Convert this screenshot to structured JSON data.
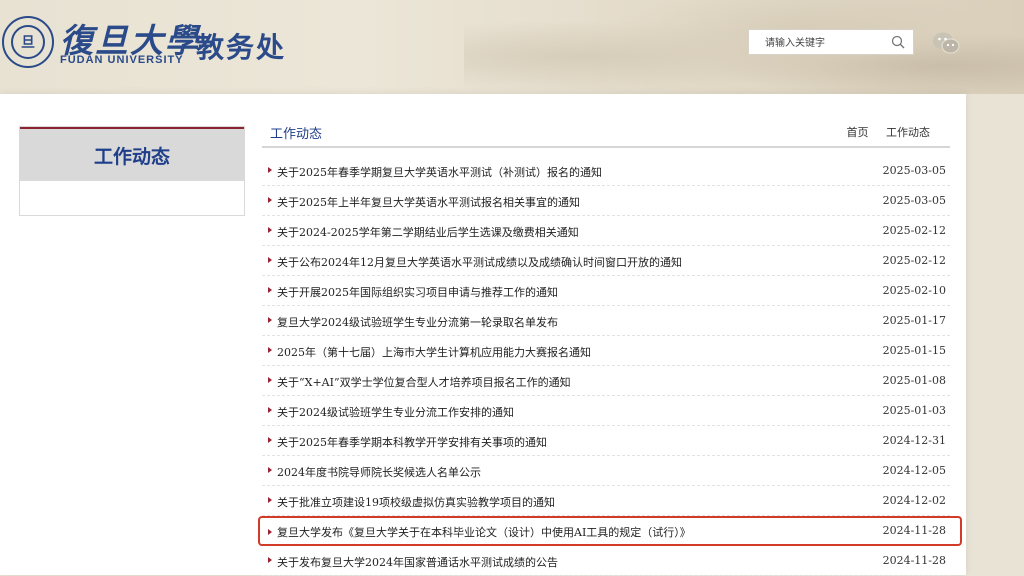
{
  "header": {
    "seal_text": "旦",
    "university_cn": "復旦大學",
    "university_en": "FUDAN UNIVERSITY",
    "department": "教务处",
    "search_placeholder": "请输入关键字",
    "search_icon": "search-icon",
    "wechat_icon": "wechat-icon"
  },
  "sidebar": {
    "title": "工作动态"
  },
  "content": {
    "title": "工作动态",
    "breadcrumb": [
      "首页",
      "工作动态"
    ],
    "items": [
      {
        "title": "关于2025年春季学期复旦大学英语水平测试（补测试）报名的通知",
        "date": "2025-03-05"
      },
      {
        "title": "关于2025年上半年复旦大学英语水平测试报名相关事宜的通知",
        "date": "2025-03-05"
      },
      {
        "title": "关于2024-2025学年第二学期结业后学生选课及缴费相关通知",
        "date": "2025-02-12"
      },
      {
        "title": "关于公布2024年12月复旦大学英语水平测试成绩以及成绩确认时间窗口开放的通知",
        "date": "2025-02-12"
      },
      {
        "title": "关于开展2025年国际组织实习项目申请与推荐工作的通知",
        "date": "2025-02-10"
      },
      {
        "title": "复旦大学2024级试验班学生专业分流第一轮录取名单发布",
        "date": "2025-01-17"
      },
      {
        "title": "2025年（第十七届）上海市大学生计算机应用能力大赛报名通知",
        "date": "2025-01-15"
      },
      {
        "title": "关于“X+AI”双学士学位复合型人才培养项目报名工作的通知",
        "date": "2025-01-08"
      },
      {
        "title": "关于2024级试验班学生专业分流工作安排的通知",
        "date": "2025-01-03"
      },
      {
        "title": "关于2025年春季学期本科教学开学安排有关事项的通知",
        "date": "2024-12-31"
      },
      {
        "title": "2024年度书院导师院长奖候选人名单公示",
        "date": "2024-12-05"
      },
      {
        "title": "关于批准立项建设19项校级虚拟仿真实验教学项目的通知",
        "date": "2024-12-02"
      },
      {
        "title": "复旦大学发布《复旦大学关于在本科毕业论文（设计）中使用AI工具的规定（试行）》",
        "date": "2024-11-28"
      },
      {
        "title": "关于发布复旦大学2024年国家普通话水平测试成绩的公告",
        "date": "2024-11-28"
      }
    ]
  }
}
